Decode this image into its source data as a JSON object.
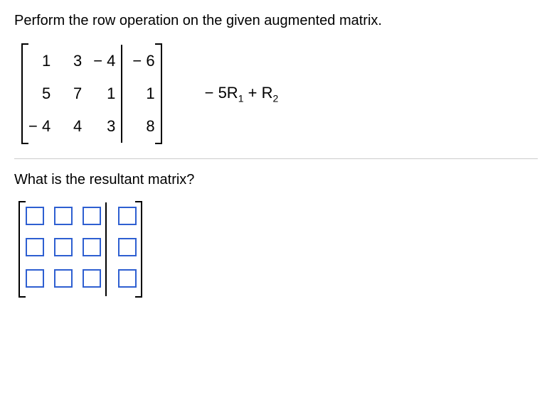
{
  "instruction": "Perform the row operation on the given augmented matrix.",
  "matrix": {
    "rows": [
      {
        "c1": "1",
        "c2": "3",
        "c3": "− 4",
        "aug": "− 6"
      },
      {
        "c1": "5",
        "c2": "7",
        "c3": "1",
        "aug": "1"
      },
      {
        "c1": "− 4",
        "c2": "4",
        "c3": "3",
        "aug": "8"
      }
    ]
  },
  "operation": {
    "prefix": "− 5R",
    "sub1": "1",
    "mid": " + R",
    "sub2": "2"
  },
  "question": "What is the resultant matrix?",
  "answer_grid": {
    "rows": 3,
    "cols": 3,
    "aug_cols": 1
  }
}
